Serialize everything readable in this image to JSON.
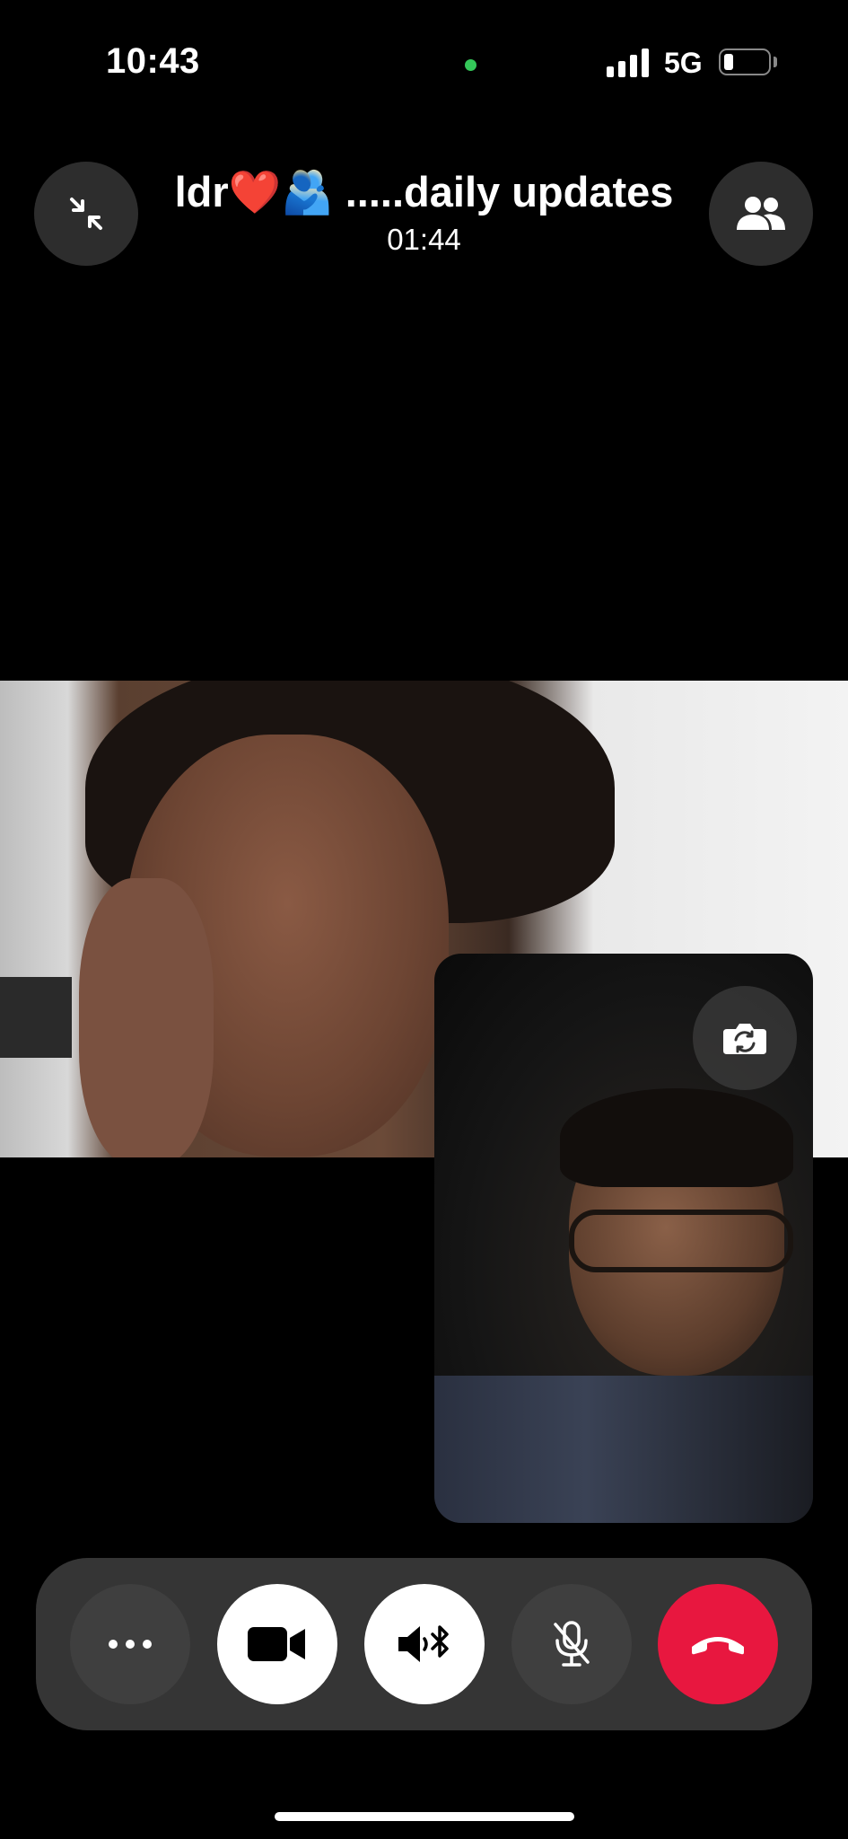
{
  "status_bar": {
    "time": "10:43",
    "network": "5G",
    "signal_bars_filled": 4,
    "battery_level": 0.2,
    "mic_indicator_color": "#34c759"
  },
  "call": {
    "title": "ldr❤️🫂 .....daily updates",
    "timer": "01:44"
  },
  "header": {
    "left_icon": "minimize-icon",
    "right_icon": "participants-icon"
  },
  "self_view": {
    "flip_icon": "camera-flip-icon"
  },
  "controls": [
    {
      "name": "more-options",
      "icon": "more-icon"
    },
    {
      "name": "video-toggle",
      "icon": "video-camera-icon"
    },
    {
      "name": "audio-output",
      "icon": "speaker-bluetooth-icon"
    },
    {
      "name": "mute",
      "icon": "mic-off-icon"
    },
    {
      "name": "end-call",
      "icon": "hang-up-icon",
      "color": "#e8173f"
    }
  ]
}
